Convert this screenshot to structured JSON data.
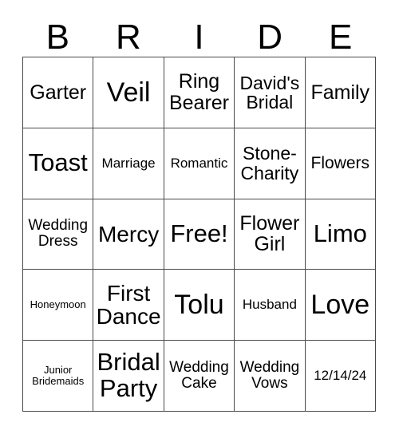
{
  "card": {
    "title_letters": [
      "B",
      "R",
      "I",
      "D",
      "E"
    ],
    "free_space_label": "Free!",
    "colors": {
      "background": "#ffffff",
      "grid_line": "#4a4a4a",
      "text": "#000000"
    },
    "columns": 5,
    "rows": 5,
    "cells": [
      [
        {
          "text": "Garter",
          "size": "fs-25"
        },
        {
          "text": "Veil",
          "size": "fs-34"
        },
        {
          "text": "Ring\nBearer",
          "size": "fs-25"
        },
        {
          "text": "David's\nBridal",
          "size": "fs-23"
        },
        {
          "text": "Family",
          "size": "fs-25"
        }
      ],
      [
        {
          "text": "Toast",
          "size": "fs-31"
        },
        {
          "text": "Marriage",
          "size": "fs-17"
        },
        {
          "text": "Romantic",
          "size": "fs-17"
        },
        {
          "text": "Stone-\nCharity",
          "size": "fs-23"
        },
        {
          "text": "Flowers",
          "size": "fs-21"
        }
      ],
      [
        {
          "text": "Wedding\nDress",
          "size": "fs-19"
        },
        {
          "text": "Mercy",
          "size": "fs-28"
        },
        {
          "text": "Free!",
          "size": "fs-31"
        },
        {
          "text": "Flower\nGirl",
          "size": "fs-25"
        },
        {
          "text": "Limo",
          "size": "fs-31"
        }
      ],
      [
        {
          "text": "Honeymoon",
          "size": "fs-13"
        },
        {
          "text": "First\nDance",
          "size": "fs-28"
        },
        {
          "text": "Tolu",
          "size": "fs-34"
        },
        {
          "text": "Husband",
          "size": "fs-17"
        },
        {
          "text": "Love",
          "size": "fs-34"
        }
      ],
      [
        {
          "text": "Junior\nBridemaids",
          "size": "fs-13"
        },
        {
          "text": "Bridal\nParty",
          "size": "fs-31"
        },
        {
          "text": "Wedding\nCake",
          "size": "fs-19"
        },
        {
          "text": "Wedding\nVows",
          "size": "fs-19"
        },
        {
          "text": "12/14/24",
          "size": "fs-17"
        }
      ]
    ]
  }
}
